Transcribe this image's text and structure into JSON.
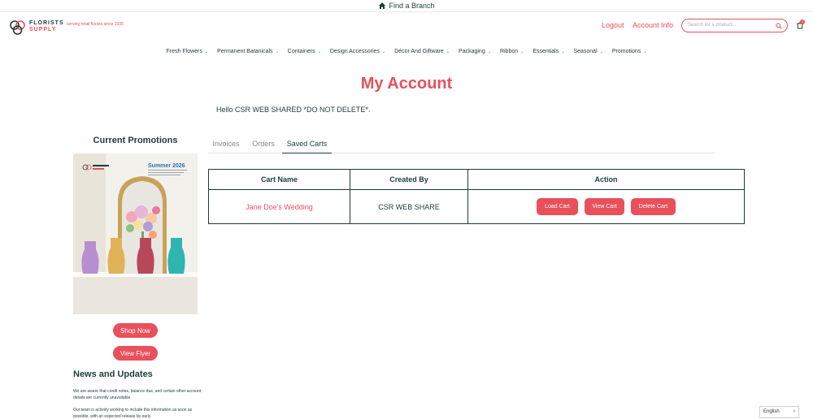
{
  "topbar": {
    "find_branch": "Find a Branch",
    "home_icon": "home-icon"
  },
  "header": {
    "logo_line1": "FLORISTS",
    "logo_line2": "SUPPLY",
    "tagline": "serving retail florists since 1935",
    "logout": "Logout",
    "account_info": "Account Info",
    "search_placeholder": "Search for a product...",
    "cart_count": "1"
  },
  "nav": {
    "items": [
      {
        "label": "Fresh Flowers"
      },
      {
        "label": "Permanent Batanicals"
      },
      {
        "label": "Containers"
      },
      {
        "label": "Design Accessories"
      },
      {
        "label": "Décor And Giftware"
      },
      {
        "label": "Packaging"
      },
      {
        "label": "Ribbon"
      },
      {
        "label": "Essentials"
      },
      {
        "label": "Seasonal"
      },
      {
        "label": "Promotions"
      }
    ]
  },
  "main": {
    "title": "My Account",
    "greeting": "Hello CSR WEB SHARED *DO NOT DELETE*."
  },
  "sidebar": {
    "promo_heading": "Current Promotions",
    "flyer_label": "Summer 2026",
    "shop_now": "Shop Now",
    "view_flyer": "View Flyer",
    "news_heading": "News and Updates",
    "news_p1": "We are aware that credit notes, balance due, and certain other account details are currently unavailable.",
    "news_p2": "Our team is actively working to include this information as soon as possible, with an expected release by early"
  },
  "tabs": [
    {
      "label": "Invoices",
      "active": false
    },
    {
      "label": "Orders",
      "active": false
    },
    {
      "label": "Saved Carts",
      "active": true
    }
  ],
  "saved_carts": {
    "headers": [
      "Cart Name",
      "Created By",
      "Action"
    ],
    "rows": [
      {
        "name": "Jane Doe's Wedding",
        "created_by": "CSR WEB SHARE",
        "actions": [
          "Load Cart",
          "View Cart",
          "Delete Cart"
        ]
      }
    ]
  },
  "language": {
    "selected": "English"
  },
  "colors": {
    "accent": "#e8505b",
    "text": "#1d3b3a"
  }
}
